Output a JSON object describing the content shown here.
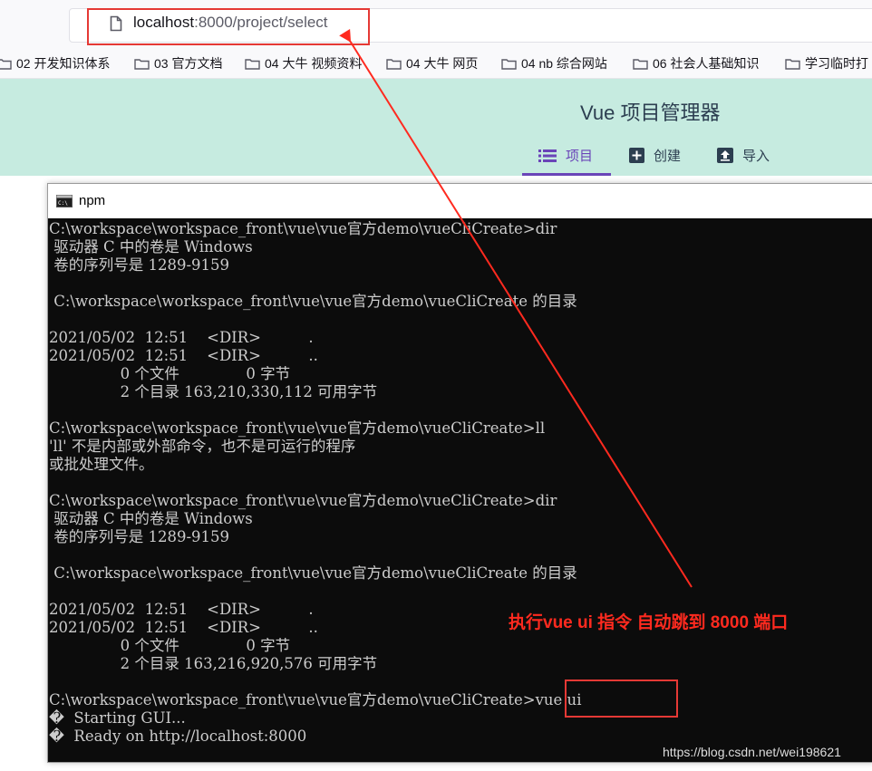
{
  "browser": {
    "url_host": "localhost",
    "url_rest": ":8000/project/select"
  },
  "bookmarks": [
    {
      "label": "02 开发知识体系"
    },
    {
      "label": "03 官方文档"
    },
    {
      "label": "04 大牛 视频资料"
    },
    {
      "label": "04 大牛 网页"
    },
    {
      "label": "04 nb 综合网站"
    },
    {
      "label": "06 社会人基础知识"
    },
    {
      "label": "学习临时打"
    }
  ],
  "vue_ui": {
    "title": "Vue 项目管理器",
    "tabs": [
      {
        "label": "项目",
        "icon": "list-icon",
        "active": true
      },
      {
        "label": "创建",
        "icon": "plus-square-icon",
        "active": false
      },
      {
        "label": "导入",
        "icon": "import-icon",
        "active": false
      }
    ],
    "accent_color": "#6a44b8",
    "header_bg": "#c6ebe0"
  },
  "terminal": {
    "title": "npm",
    "lines": [
      "C:\\workspace\\workspace_front\\vue\\vue官方demo\\vueCliCreate>dir",
      " 驱动器 C 中的卷是 Windows",
      " 卷的序列号是 1289-9159",
      "",
      " C:\\workspace\\workspace_front\\vue\\vue官方demo\\vueCliCreate 的目录",
      "",
      "2021/05/02  12:51    <DIR>          .",
      "2021/05/02  12:51    <DIR>          ..",
      "               0 个文件              0 字节",
      "               2 个目录 163,210,330,112 可用字节",
      "",
      "C:\\workspace\\workspace_front\\vue\\vue官方demo\\vueCliCreate>ll",
      "'ll' 不是内部或外部命令，也不是可运行的程序",
      "或批处理文件。",
      "",
      "C:\\workspace\\workspace_front\\vue\\vue官方demo\\vueCliCreate>dir",
      " 驱动器 C 中的卷是 Windows",
      " 卷的序列号是 1289-9159",
      "",
      " C:\\workspace\\workspace_front\\vue\\vue官方demo\\vueCliCreate 的目录",
      "",
      "2021/05/02  12:51    <DIR>          .",
      "2021/05/02  12:51    <DIR>          ..",
      "               0 个文件              0 字节",
      "               2 个目录 163,216,920,576 可用字节",
      "",
      "C:\\workspace\\workspace_front\\vue\\vue官方demo\\vueCliCreate>vue ui",
      "�  Starting GUI...",
      "�  Ready on http://localhost:8000"
    ]
  },
  "annotation": {
    "text": "执行vue ui 指令  自动跳到 8000 端口",
    "color": "#ff2a1f"
  },
  "watermark": "https://blog.csdn.net/wei198621"
}
